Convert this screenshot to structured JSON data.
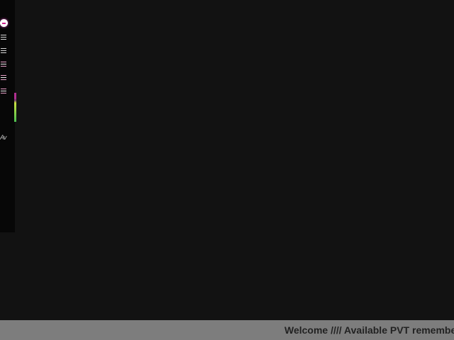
{
  "sidebar": {
    "logo_icon": "brand-logo-icon",
    "items": [
      {
        "icon": "menu-lines-icon"
      },
      {
        "icon": "menu-lines-icon"
      },
      {
        "icon": "menu-lines-icon"
      },
      {
        "icon": "menu-lines-icon"
      },
      {
        "icon": "menu-lines-icon"
      }
    ],
    "mode_label": "Av"
  },
  "ticker": {
    "text": "Welcome //// Available PVT remembe"
  },
  "colors": {
    "background": "#121212",
    "sidebar": "#070707",
    "ticker_bg": "#7d7d7d",
    "ticker_text": "#222222",
    "accent_pink": "#d02090",
    "accent_green": "#4cc050"
  }
}
